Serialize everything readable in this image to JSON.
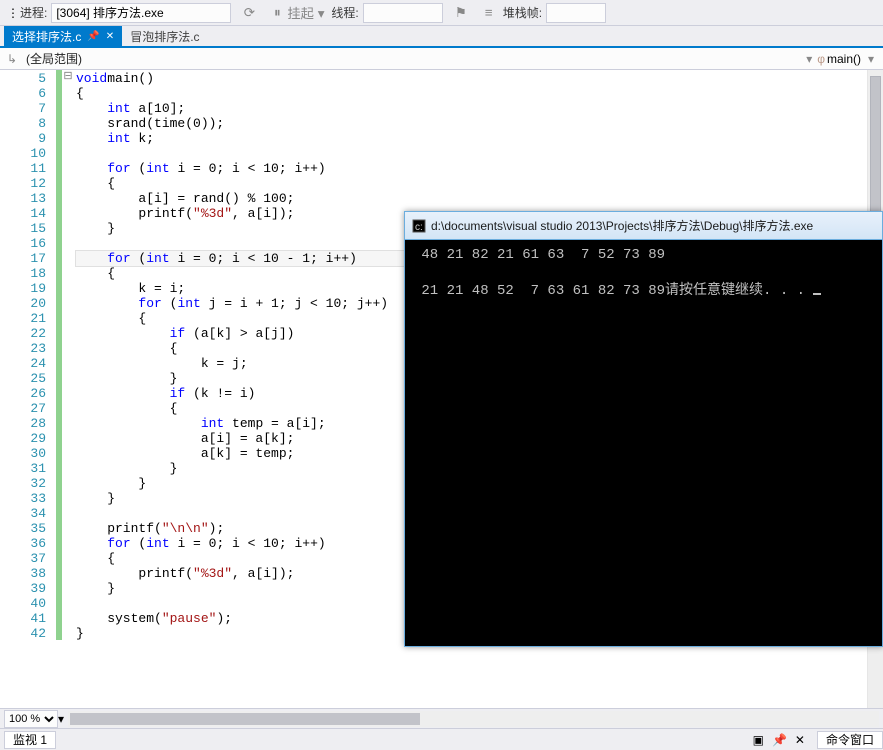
{
  "toolbar": {
    "process_label": "进程:",
    "process_value": "[3064] 排序方法.exe",
    "suspend_label": "挂起 ▾",
    "thread_label": "线程:",
    "stack_label": "堆栈帧:"
  },
  "tabs": {
    "active": {
      "label": "选择排序法.c",
      "pin": "📌",
      "close": "✕"
    },
    "inactive": {
      "label": "冒泡排序法.c"
    }
  },
  "crumb": {
    "scope": "(全局范围)",
    "member_icon": "φ",
    "member": "main()"
  },
  "code_lines": [
    {
      "n": 5,
      "fold": "⊟",
      "raw": "void main()",
      "tok": [
        [
          "kw",
          "void"
        ],
        [
          " ",
          "main()"
        ]
      ]
    },
    {
      "n": 6,
      "raw": "{"
    },
    {
      "n": 7,
      "raw": "    int a[10];",
      "tok": [
        [
          "",
          "    "
        ],
        [
          "kw",
          "int"
        ],
        [
          "",
          " a[10];"
        ]
      ]
    },
    {
      "n": 8,
      "raw": "    srand(time(0));"
    },
    {
      "n": 9,
      "raw": "    int k;",
      "tok": [
        [
          "",
          "    "
        ],
        [
          "kw",
          "int"
        ],
        [
          "",
          " k;"
        ]
      ]
    },
    {
      "n": 10,
      "raw": ""
    },
    {
      "n": 11,
      "raw": "    for (int i = 0; i < 10; i++)",
      "tok": [
        [
          "",
          "    "
        ],
        [
          "kw",
          "for"
        ],
        [
          "",
          " ("
        ],
        [
          "kw",
          "int"
        ],
        [
          "",
          " i = 0; i < 10; i++)"
        ]
      ]
    },
    {
      "n": 12,
      "raw": "    {"
    },
    {
      "n": 13,
      "raw": "        a[i] = rand() % 100;"
    },
    {
      "n": 14,
      "raw": "        printf(\"%3d\", a[i]);",
      "tok": [
        [
          "",
          "        printf("
        ],
        [
          "str",
          "\"%3d\""
        ],
        [
          "",
          ", a[i]);"
        ]
      ]
    },
    {
      "n": 15,
      "raw": "    }"
    },
    {
      "n": 16,
      "raw": ""
    },
    {
      "n": 17,
      "raw": "    for (int i = 0; i < 10 - 1; i++)",
      "cur": true,
      "tok": [
        [
          "",
          "    "
        ],
        [
          "kw",
          "for"
        ],
        [
          "",
          " ("
        ],
        [
          "kw",
          "int"
        ],
        [
          "",
          " i = 0; i < 10 - 1; i++)"
        ]
      ]
    },
    {
      "n": 18,
      "raw": "    {"
    },
    {
      "n": 19,
      "raw": "        k = i;"
    },
    {
      "n": 20,
      "raw": "        for (int j = i + 1; j < 10; j++)",
      "tok": [
        [
          "",
          "        "
        ],
        [
          "kw",
          "for"
        ],
        [
          "",
          " ("
        ],
        [
          "kw",
          "int"
        ],
        [
          "",
          " j = i + 1; j < 10; j++)"
        ]
      ]
    },
    {
      "n": 21,
      "raw": "        {"
    },
    {
      "n": 22,
      "raw": "            if (a[k] > a[j])",
      "tok": [
        [
          "",
          "            "
        ],
        [
          "kw",
          "if"
        ],
        [
          "",
          " (a[k] > a[j])"
        ]
      ]
    },
    {
      "n": 23,
      "raw": "            {"
    },
    {
      "n": 24,
      "raw": "                k = j;"
    },
    {
      "n": 25,
      "raw": "            }"
    },
    {
      "n": 26,
      "raw": "            if (k != i)",
      "tok": [
        [
          "",
          "            "
        ],
        [
          "kw",
          "if"
        ],
        [
          "",
          " (k != i)"
        ]
      ]
    },
    {
      "n": 27,
      "raw": "            {"
    },
    {
      "n": 28,
      "raw": "                int temp = a[i];",
      "tok": [
        [
          "",
          "                "
        ],
        [
          "kw",
          "int"
        ],
        [
          "",
          " temp = a[i];"
        ]
      ]
    },
    {
      "n": 29,
      "raw": "                a[i] = a[k];"
    },
    {
      "n": 30,
      "raw": "                a[k] = temp;"
    },
    {
      "n": 31,
      "raw": "            }"
    },
    {
      "n": 32,
      "raw": "        }"
    },
    {
      "n": 33,
      "raw": "    }"
    },
    {
      "n": 34,
      "raw": ""
    },
    {
      "n": 35,
      "raw": "    printf(\"\\n\\n\");",
      "tok": [
        [
          "",
          "    printf("
        ],
        [
          "str",
          "\"\\n\\n\""
        ],
        [
          "",
          ");"
        ]
      ]
    },
    {
      "n": 36,
      "raw": "    for (int i = 0; i < 10; i++)",
      "tok": [
        [
          "",
          "    "
        ],
        [
          "kw",
          "for"
        ],
        [
          "",
          " ("
        ],
        [
          "kw",
          "int"
        ],
        [
          "",
          " i = 0; i < 10; i++)"
        ]
      ]
    },
    {
      "n": 37,
      "raw": "    {"
    },
    {
      "n": 38,
      "raw": "        printf(\"%3d\", a[i]);",
      "tok": [
        [
          "",
          "        printf("
        ],
        [
          "str",
          "\"%3d\""
        ],
        [
          "",
          ", a[i]);"
        ]
      ]
    },
    {
      "n": 39,
      "raw": "    }"
    },
    {
      "n": 40,
      "raw": ""
    },
    {
      "n": 41,
      "raw": "    system(\"pause\");",
      "tok": [
        [
          "",
          "    system("
        ],
        [
          "str",
          "\"pause\""
        ],
        [
          "",
          ");"
        ]
      ]
    },
    {
      "n": 42,
      "raw": "}"
    }
  ],
  "zoom": {
    "value": "100 %"
  },
  "status": {
    "watch_tab": "监视 1",
    "cmd_tab": "命令窗口"
  },
  "console": {
    "title": "d:\\documents\\visual studio 2013\\Projects\\排序方法\\Debug\\排序方法.exe",
    "line1": " 48 21 82 21 61 63  7 52 73 89",
    "line2a": " 21 21 48 52  7 63 61 82 73 89",
    "line2b": "请按任意键继续. . . "
  }
}
